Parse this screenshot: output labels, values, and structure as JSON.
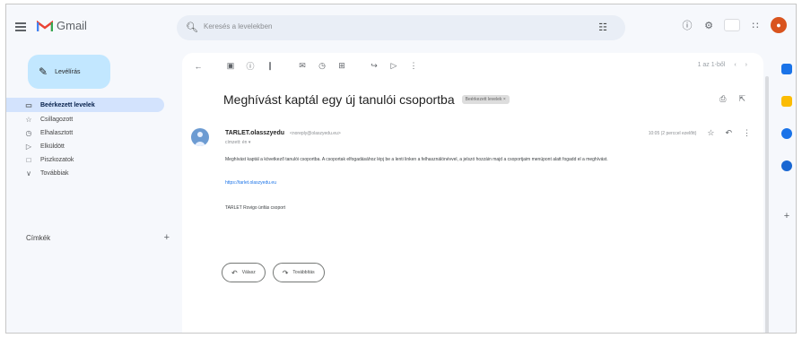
{
  "app": {
    "name": "Gmail"
  },
  "search": {
    "placeholder": "Keresés a levelekben"
  },
  "compose": {
    "label": "Levélírás"
  },
  "nav": {
    "items": [
      {
        "label": "Beérkezett levelek",
        "icon": "inbox-icon"
      },
      {
        "label": "Csillagozott",
        "icon": "star-icon"
      },
      {
        "label": "Elhalasztott",
        "icon": "clock-icon"
      },
      {
        "label": "Elküldött",
        "icon": "send-icon"
      },
      {
        "label": "Piszkozatok",
        "icon": "draft-icon"
      },
      {
        "label": "Továbbiak",
        "icon": "chevron-down-icon"
      }
    ]
  },
  "labels": {
    "title": "Címkék"
  },
  "email": {
    "subject": "Meghívást kaptál egy új tanulói csoportba",
    "folder_chip": "Beérkezett levelek ×",
    "sender_name": "TARLET.olasszyedu",
    "sender_email": "<noreply@olaszyedu.eu>",
    "recipient": "címzett: én ▾",
    "time": "10:05 (2 perccel ezelőtt)",
    "body": "Meghívást kaptál a következő tanulói csoportba. A csoportak elfogadásához lépj be a lenti linken a felhasználónévvel, a jelszó hozzáin majd a csoportjaim menüpont alatt fogadd el a meghívást.",
    "link": "https://tarlet.olaszyedu.eu",
    "code": "TARLET Rovigo ünfás csoport",
    "reply_label": "Válasz",
    "forward_label": "Továbbítás"
  },
  "pager": {
    "label": "1 az 1-ből"
  },
  "colors": {
    "background": "#f6f8fc",
    "compose": "#c2e7ff",
    "active_nav": "#d3e3fd",
    "link": "#1a73e8",
    "avatar": "#d9541e"
  }
}
